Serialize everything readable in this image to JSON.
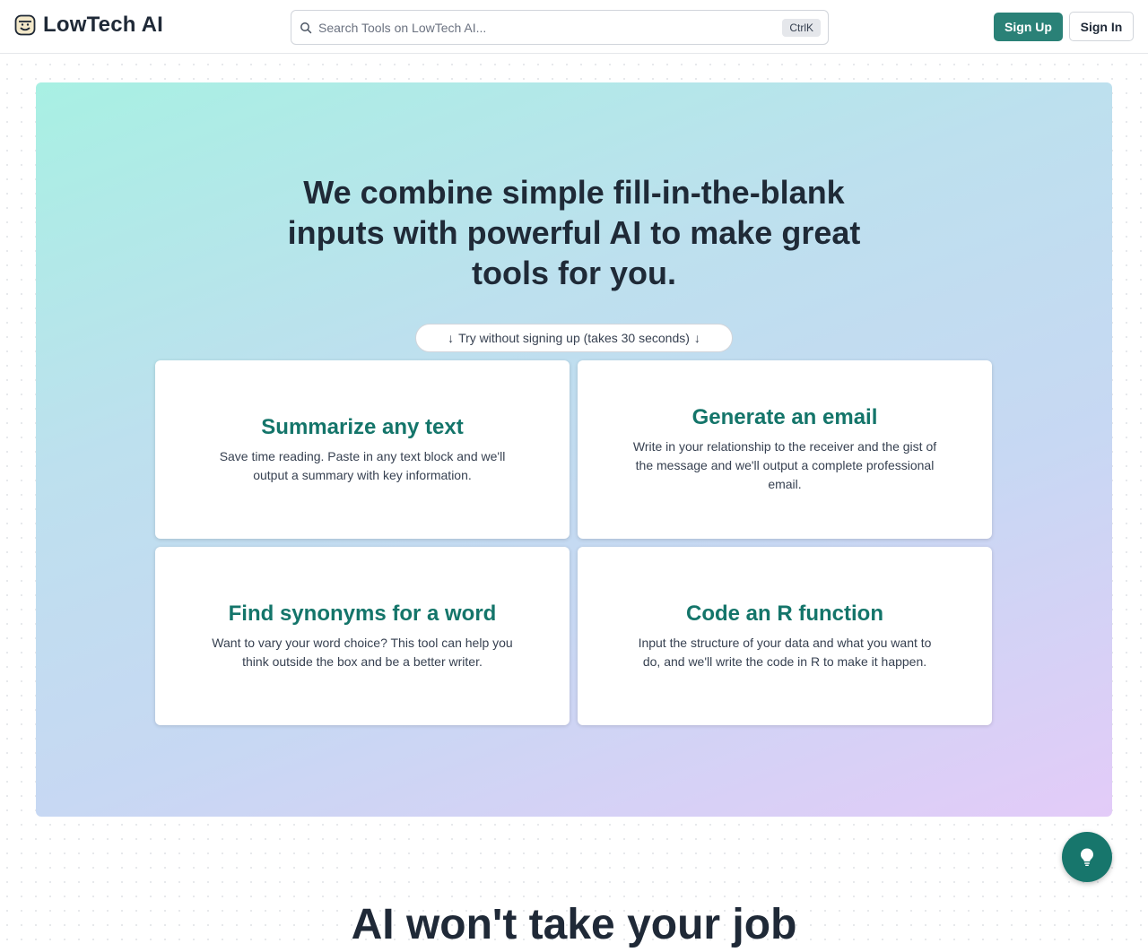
{
  "header": {
    "brand": "LowTech AI",
    "search_placeholder": "Search Tools on LowTech AI...",
    "search_shortcut": "CtrlK",
    "signup_label": "Sign Up",
    "signin_label": "Sign In"
  },
  "hero": {
    "title_lines": [
      "We combine simple fill-in-the-blank",
      "inputs with powerful AI to make great",
      "tools for you."
    ],
    "try_label": "Try without signing up (takes 30 seconds)"
  },
  "cards": [
    {
      "title": "Summarize any text",
      "description": "Save time reading. Paste in any text block and we'll output a summary with key information."
    },
    {
      "title": "Generate an email",
      "description": "Write in your relationship to the receiver and the gist of the message and we'll output a complete professional email."
    },
    {
      "title": "Find synonyms for a word",
      "description": "Want to vary your word choice? This tool can help you think outside the box and be a better writer."
    },
    {
      "title": "Code an R function",
      "description": "Input the structure of your data and what you want to do, and we'll write the code in R to make it happen."
    }
  ],
  "bottom_heading": "AI won't take your job",
  "colors": {
    "brand_teal": "#2a8177",
    "card_title": "#14756a",
    "fab": "#17766c"
  },
  "icons": {
    "logo": "smiling-face-icon",
    "search": "search-icon",
    "try_arrows": "arrow-down-icon",
    "fab": "lightbulb-icon"
  }
}
